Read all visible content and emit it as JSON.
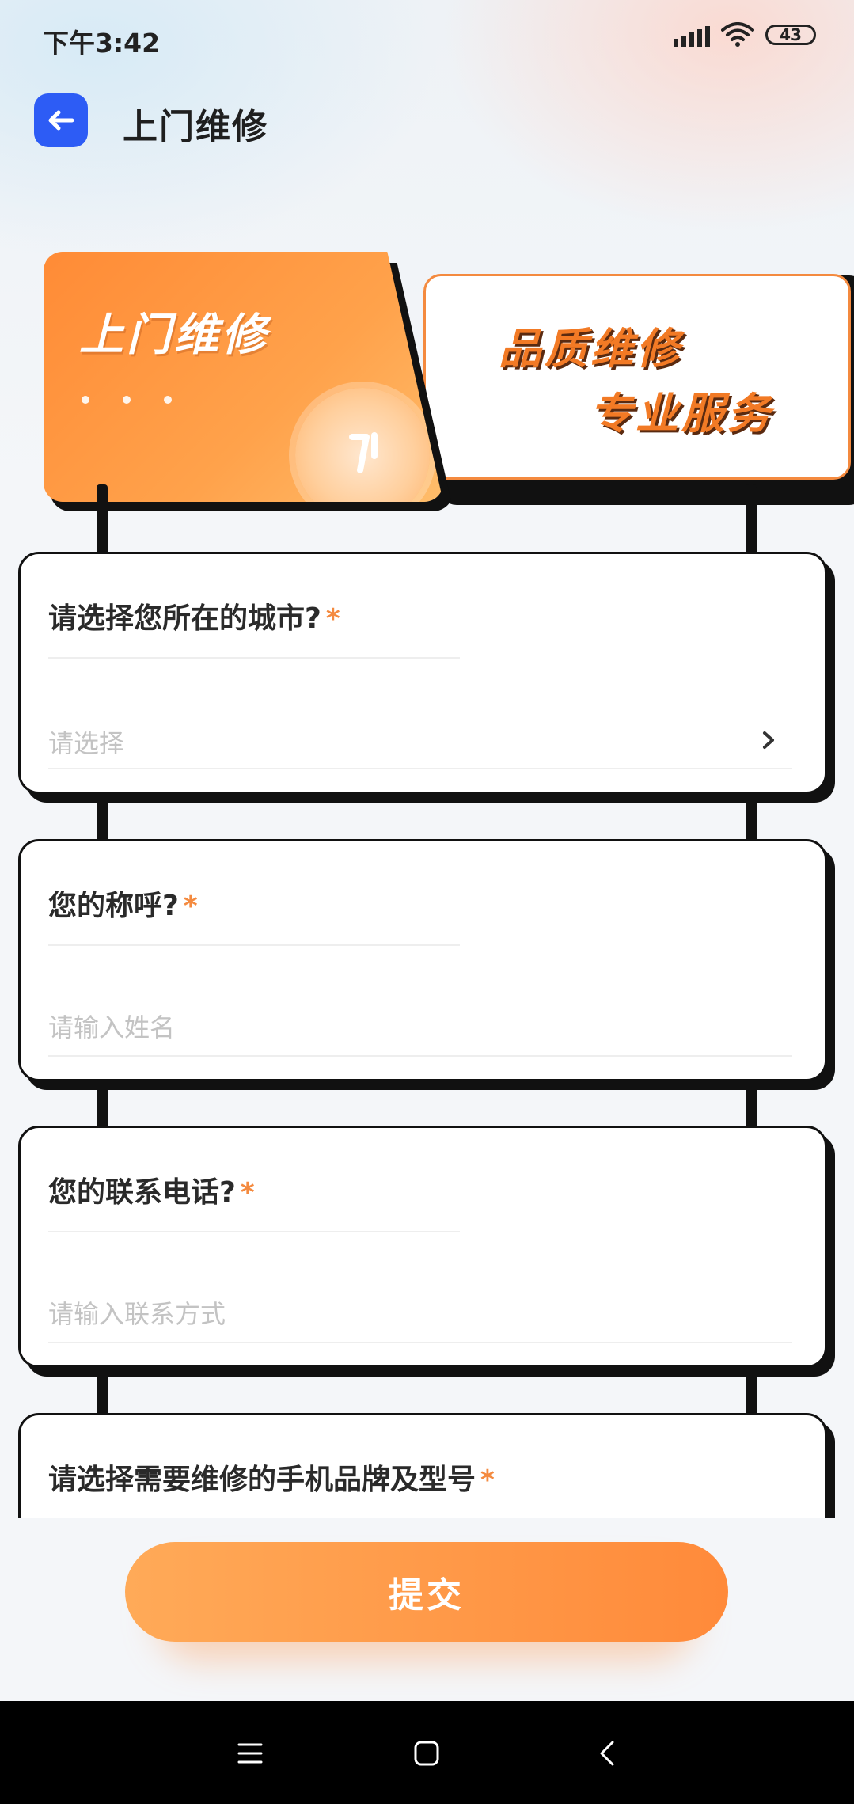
{
  "status_bar": {
    "time": "下午3:42",
    "battery": "43"
  },
  "header": {
    "title": "上门维修"
  },
  "banner": {
    "title": "上门维修",
    "slogan_line1": "品质维修",
    "slogan_line2": "专业服务"
  },
  "form": {
    "required_mark": "*",
    "city": {
      "label": "请选择您所在的城市?",
      "placeholder": "请选择"
    },
    "name": {
      "label": "您的称呼?",
      "placeholder": "请输入姓名"
    },
    "phone": {
      "label": "您的联系电话?",
      "placeholder": "请输入联系方式"
    },
    "model": {
      "label": "请选择需要维修的手机品牌及型号"
    }
  },
  "submit": {
    "label": "提交"
  },
  "icons": [
    "back-arrow-icon",
    "chevron-right-icon",
    "signal-icon",
    "wifi-icon",
    "battery-icon",
    "menu-icon",
    "home-icon",
    "back-icon"
  ],
  "colors": {
    "accent": "#2d5cf5",
    "orange": "#f48a3f"
  }
}
